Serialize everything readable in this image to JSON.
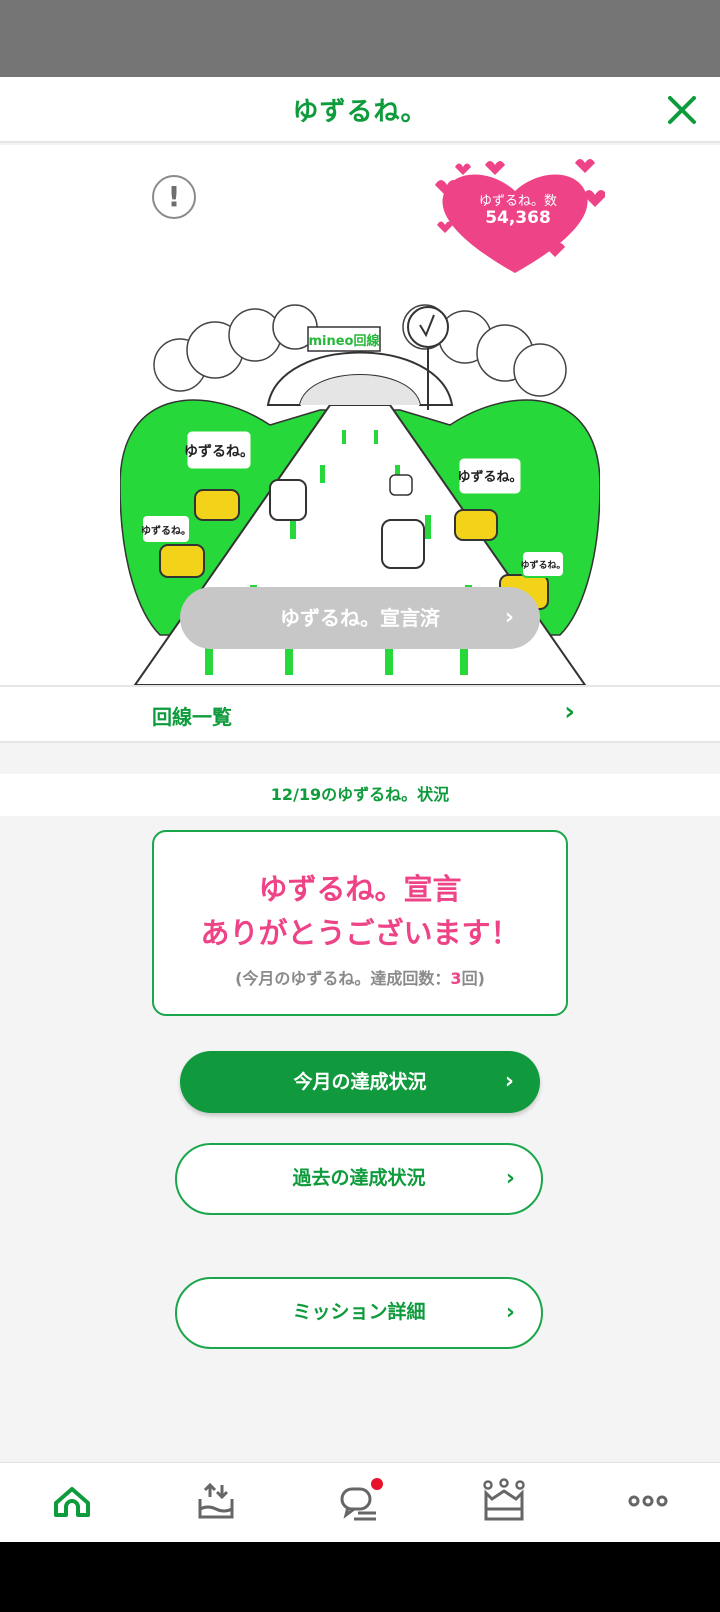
{
  "header": {
    "title": "ゆずるね。"
  },
  "hero": {
    "counter_label": "ゆずるね。数",
    "counter_value": "54,368",
    "info_glyph": "!",
    "illustration": {
      "tunnel_sign": "mineo回線",
      "bubble_text": "ゆずるね。"
    },
    "declare_button_label": "ゆずるね。宣言済"
  },
  "line_list": {
    "label": "回線一覧"
  },
  "status": {
    "heading": "12/19のゆずるね。状況",
    "card": {
      "line1": "ゆずるね。宣言",
      "line2": "ありがとうございます！",
      "sub_prefix": "(今月のゆずるね。達成回数：",
      "sub_count": "3",
      "sub_suffix": "回)"
    }
  },
  "buttons": {
    "this_month": "今月の達成状況",
    "past": "過去の達成状況",
    "mission": "ミッション詳細",
    "chevron": "›"
  },
  "tabbar": {
    "items": [
      {
        "icon": "home-icon",
        "active": true
      },
      {
        "icon": "data-upload-icon",
        "active": false
      },
      {
        "icon": "chat-icon",
        "active": false,
        "badge": true
      },
      {
        "icon": "crown-icon",
        "active": false
      },
      {
        "icon": "more-icon",
        "active": false
      }
    ]
  },
  "colors": {
    "brand_green": "#0e9b3c",
    "accent_pink": "#ee4487",
    "disabled_gray": "#c7c7c7",
    "badge_red": "#e8132a"
  }
}
